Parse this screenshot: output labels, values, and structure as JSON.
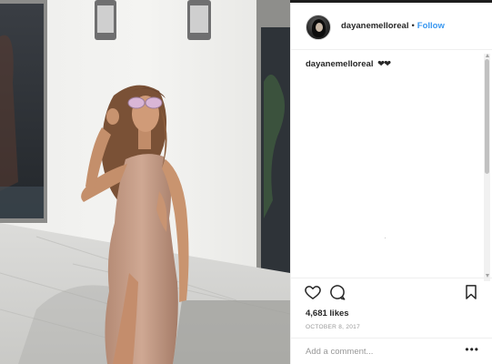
{
  "post": {
    "username": "dayanemelloreal",
    "separator": "•",
    "follow_label": "Follow",
    "caption_username": "dayanemelloreal",
    "caption_text": "❤❤",
    "likes_text": "4,681 likes",
    "date_text": "OCTOBER 8, 2017",
    "comment_placeholder": "Add a comment...",
    "more_label": "•••"
  },
  "icons": {
    "like": "heart-outline-icon",
    "comment": "speech-bubble-icon",
    "save": "bookmark-icon",
    "more": "ellipsis-icon"
  },
  "colors": {
    "follow_link": "#3897f0",
    "text": "#262626",
    "muted": "#999999",
    "border": "#efefef"
  }
}
